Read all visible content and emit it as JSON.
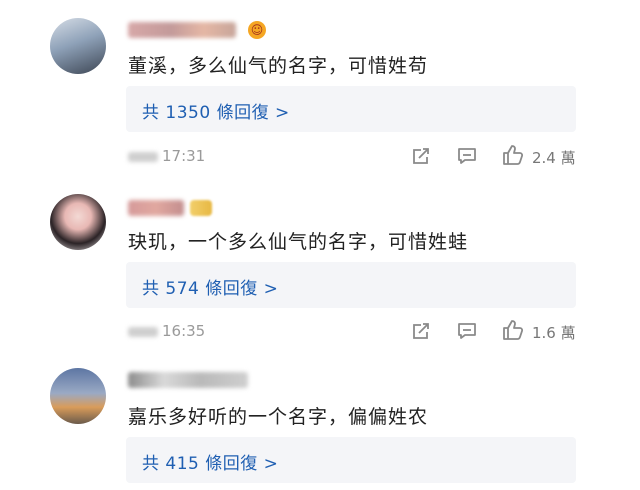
{
  "comments": [
    {
      "text": "董溪，多么仙气的名字，可惜姓苟",
      "replies": "共 1350 條回復 >",
      "time": "17:31",
      "likes": "2.4 萬"
    },
    {
      "text": "玦玑，一个多么仙气的名字，可惜姓蛙",
      "replies": "共 574 條回復 >",
      "time": "16:35",
      "likes": "1.6 萬"
    },
    {
      "text": "嘉乐多好听的一个名字，偏偏姓农",
      "replies": "共 415 條回復 >"
    }
  ]
}
